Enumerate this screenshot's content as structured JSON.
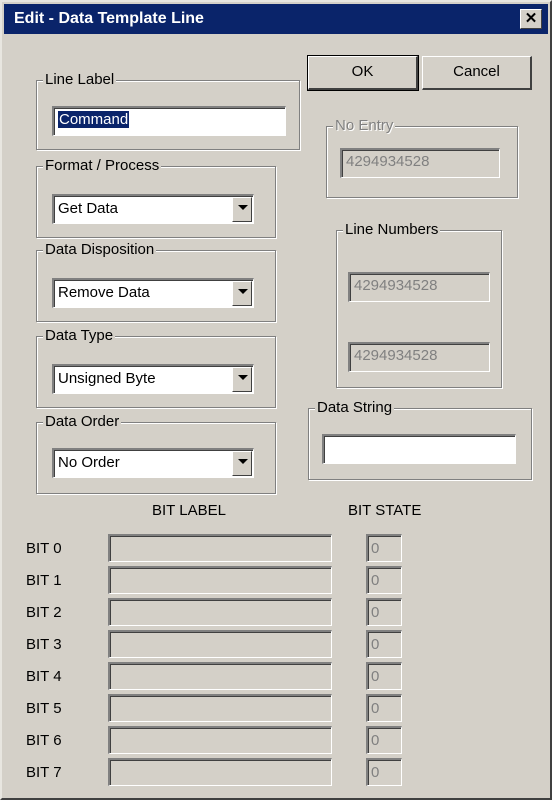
{
  "window": {
    "title": "Edit - Data Template Line",
    "close_glyph": "✕"
  },
  "buttons": {
    "ok": "OK",
    "cancel": "Cancel"
  },
  "line_label": {
    "legend": "Line Label",
    "value": "Command"
  },
  "no_entry": {
    "legend": "No Entry",
    "value": "4294934528"
  },
  "format_process": {
    "legend": "Format / Process",
    "value": "Get Data"
  },
  "line_numbers": {
    "legend": "Line Numbers",
    "first": "4294934528",
    "second": "4294934528"
  },
  "data_disposition": {
    "legend": "Data Disposition",
    "value": "Remove Data"
  },
  "data_type": {
    "legend": "Data Type",
    "value": "Unsigned Byte"
  },
  "data_string": {
    "legend": "Data String",
    "value": ""
  },
  "data_order": {
    "legend": "Data Order",
    "value": "No Order"
  },
  "bits": {
    "label_header": "BIT LABEL",
    "state_header": "BIT STATE",
    "rows": [
      {
        "name": "BIT 0",
        "label": "",
        "state": "0"
      },
      {
        "name": "BIT 1",
        "label": "",
        "state": "0"
      },
      {
        "name": "BIT 2",
        "label": "",
        "state": "0"
      },
      {
        "name": "BIT 3",
        "label": "",
        "state": "0"
      },
      {
        "name": "BIT 4",
        "label": "",
        "state": "0"
      },
      {
        "name": "BIT 5",
        "label": "",
        "state": "0"
      },
      {
        "name": "BIT 6",
        "label": "",
        "state": "0"
      },
      {
        "name": "BIT 7",
        "label": "",
        "state": "0"
      }
    ]
  }
}
